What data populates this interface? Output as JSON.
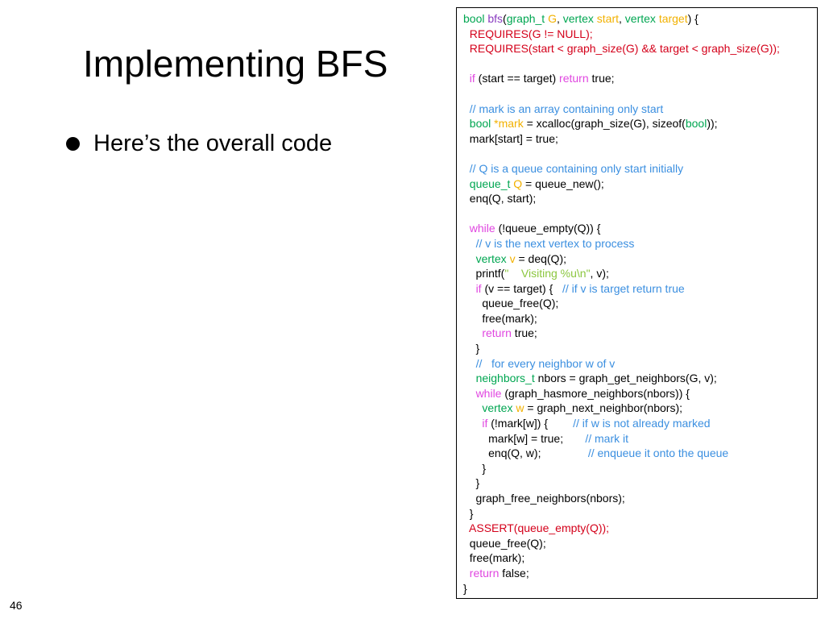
{
  "slide": {
    "title": "Implementing BFS",
    "bullet": "Here’s the overall code",
    "page_number": "46"
  },
  "colors": {
    "type": "#00a651",
    "variable": "#f2b100",
    "function_name": "#8a3cc0",
    "keyword": "#e046e0",
    "comment": "#3b8fe0",
    "contract": "#d4001a",
    "string": "#8bc63e"
  },
  "code": {
    "lines": [
      [
        [
          "type",
          "bool "
        ],
        [
          "fn",
          "bfs"
        ],
        [
          "pl",
          "("
        ],
        [
          "type",
          "graph_t "
        ],
        [
          "var",
          "G"
        ],
        [
          "pl",
          ", "
        ],
        [
          "type",
          "vertex "
        ],
        [
          "var",
          "start"
        ],
        [
          "pl",
          ", "
        ],
        [
          "type",
          "vertex "
        ],
        [
          "var",
          "target"
        ],
        [
          "pl",
          ") {"
        ]
      ],
      [
        [
          "pl",
          "  "
        ],
        [
          "red",
          "REQUIRES(G != NULL);"
        ]
      ],
      [
        [
          "pl",
          "  "
        ],
        [
          "red",
          "REQUIRES(start < graph_size(G) && target < graph_size(G));"
        ]
      ],
      [],
      [
        [
          "pl",
          "  "
        ],
        [
          "kw",
          "if"
        ],
        [
          "pl",
          " (start == target) "
        ],
        [
          "kw",
          "return"
        ],
        [
          "pl",
          " true;"
        ]
      ],
      [],
      [
        [
          "pl",
          "  "
        ],
        [
          "cmt",
          "// mark is an array containing only start"
        ]
      ],
      [
        [
          "pl",
          "  "
        ],
        [
          "type",
          "bool "
        ],
        [
          "var",
          "*mark"
        ],
        [
          "pl",
          " = xcalloc(graph_size(G), sizeof("
        ],
        [
          "type",
          "bool"
        ],
        [
          "pl",
          "));"
        ]
      ],
      [
        [
          "pl",
          "  mark[start] = true;"
        ]
      ],
      [],
      [
        [
          "pl",
          "  "
        ],
        [
          "cmt",
          "// Q is a queue containing only start initially"
        ]
      ],
      [
        [
          "pl",
          "  "
        ],
        [
          "type",
          "queue_t "
        ],
        [
          "var",
          "Q"
        ],
        [
          "pl",
          " = queue_new();"
        ]
      ],
      [
        [
          "pl",
          "  enq(Q, start);"
        ]
      ],
      [],
      [
        [
          "pl",
          "  "
        ],
        [
          "kw",
          "while"
        ],
        [
          "pl",
          " (!queue_empty(Q)) {"
        ]
      ],
      [
        [
          "pl",
          "    "
        ],
        [
          "cmt",
          "// v is the next vertex to process"
        ]
      ],
      [
        [
          "pl",
          "    "
        ],
        [
          "type",
          "vertex "
        ],
        [
          "var",
          "v"
        ],
        [
          "pl",
          " = deq(Q);"
        ]
      ],
      [
        [
          "pl",
          "    printf("
        ],
        [
          "str",
          "\"    Visiting %u\\n\""
        ],
        [
          "pl",
          ", v);"
        ]
      ],
      [
        [
          "pl",
          "    "
        ],
        [
          "kw",
          "if"
        ],
        [
          "pl",
          " (v == target) {   "
        ],
        [
          "cmt",
          "// if v is target return true"
        ]
      ],
      [
        [
          "pl",
          "      queue_free(Q);"
        ]
      ],
      [
        [
          "pl",
          "      free(mark);"
        ]
      ],
      [
        [
          "pl",
          "      "
        ],
        [
          "kw",
          "return"
        ],
        [
          "pl",
          " true;"
        ]
      ],
      [
        [
          "pl",
          "    }"
        ]
      ],
      [
        [
          "pl",
          "    "
        ],
        [
          "cmt",
          "//   for every neighbor w of v"
        ]
      ],
      [
        [
          "pl",
          "    "
        ],
        [
          "type",
          "neighbors_t"
        ],
        [
          "pl",
          " nbors = graph_get_neighbors(G, v);"
        ]
      ],
      [
        [
          "pl",
          "    "
        ],
        [
          "kw",
          "while"
        ],
        [
          "pl",
          " (graph_hasmore_neighbors(nbors)) {"
        ]
      ],
      [
        [
          "pl",
          "      "
        ],
        [
          "type",
          "vertex "
        ],
        [
          "var",
          "w"
        ],
        [
          "pl",
          " = graph_next_neighbor(nbors);"
        ]
      ],
      [
        [
          "pl",
          "      "
        ],
        [
          "kw",
          "if"
        ],
        [
          "pl",
          " (!mark[w]) {        "
        ],
        [
          "cmt",
          "// if w is not already marked"
        ]
      ],
      [
        [
          "pl",
          "        mark[w] = true;       "
        ],
        [
          "cmt",
          "// mark it"
        ]
      ],
      [
        [
          "pl",
          "        enq(Q, w);               "
        ],
        [
          "cmt",
          "// enqueue it onto the queue"
        ]
      ],
      [
        [
          "pl",
          "      }"
        ]
      ],
      [
        [
          "pl",
          "    }"
        ]
      ],
      [
        [
          "pl",
          "    graph_free_neighbors(nbors);"
        ]
      ],
      [
        [
          "pl",
          "  }"
        ]
      ],
      [
        [
          "pl",
          "  "
        ],
        [
          "red",
          "ASSERT(queue_empty(Q));"
        ]
      ],
      [
        [
          "pl",
          "  queue_free(Q);"
        ]
      ],
      [
        [
          "pl",
          "  free(mark);"
        ]
      ],
      [
        [
          "pl",
          "  "
        ],
        [
          "kw",
          "return"
        ],
        [
          "pl",
          " false;"
        ]
      ],
      [
        [
          "pl",
          "}"
        ]
      ]
    ]
  }
}
